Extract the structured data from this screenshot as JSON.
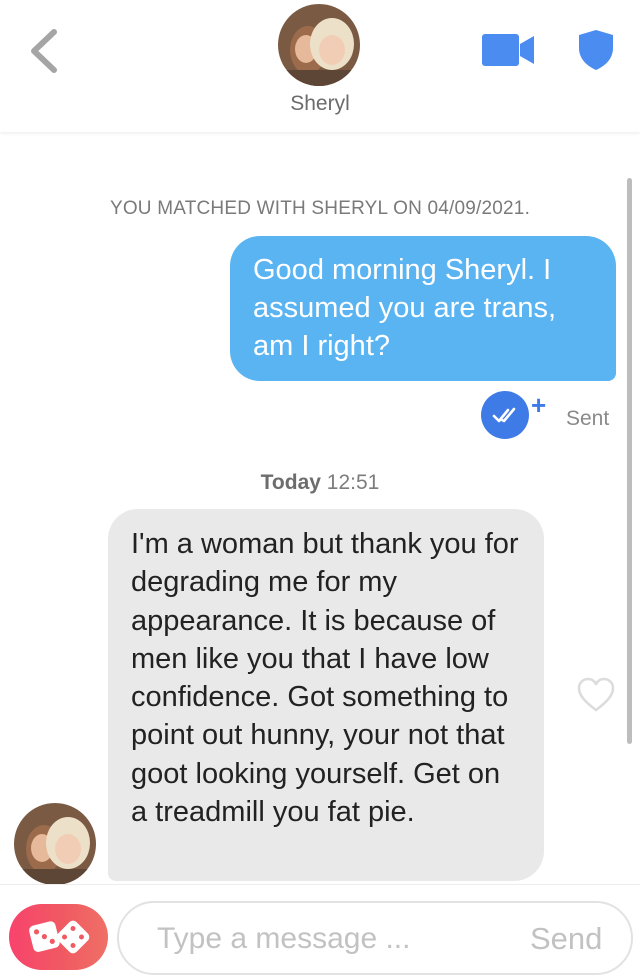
{
  "header": {
    "contact_name": "Sheryl",
    "back_icon": "chevron-left-icon",
    "video_icon": "video-camera-icon",
    "safety_icon": "shield-icon",
    "accent_color": "#4a8cf0"
  },
  "chat": {
    "match_notice": "YOU MATCHED WITH SHERYL ON 04/09/2021.",
    "messages": [
      {
        "direction": "outgoing",
        "text": "Good morning Sheryl. I assumed you are trans, am I right?",
        "status": "Sent",
        "status_icon": "double-check-icon",
        "reaction_icon": "plus-icon"
      },
      {
        "direction": "incoming",
        "text": "I'm a woman but thank you for degrading me for my appearance. It is because of men like you that I have low confidence. Got something to point out hunny, your not that goot looking yourself. Get on a treadmill you fat pie.",
        "like_icon": "heart-outline-icon"
      }
    ],
    "timestamp": {
      "day": "Today",
      "time": "12:51"
    },
    "colors": {
      "outgoing_bubble": "#5bb4f2",
      "incoming_bubble": "#e9e9e9"
    }
  },
  "composer": {
    "placeholder": "Type a message ...",
    "value": "",
    "send_label": "Send",
    "gif_icon": "dice-icon",
    "gif_gradient": [
      "#f8436d",
      "#ef7066"
    ]
  }
}
